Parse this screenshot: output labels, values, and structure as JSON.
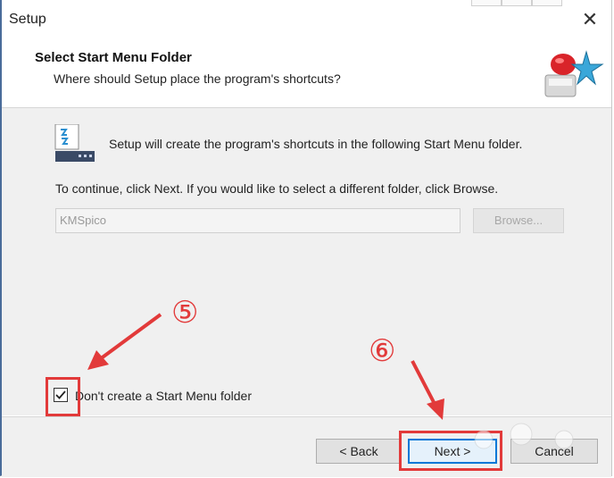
{
  "window": {
    "title": "Setup",
    "close_glyph": "✕"
  },
  "header": {
    "title": "Select Start Menu Folder",
    "subtitle": "Where should Setup place the program's shortcuts?",
    "logo_icon": "setup-wizard-logo-icon"
  },
  "body": {
    "folder_icon": "start-menu-folder-icon",
    "info_text": "Setup will create the program's shortcuts in the following Start Menu folder.",
    "continue_text": "To continue, click Next. If you would like to select a different folder, click Browse.",
    "folder_input_value": "KMSpico",
    "browse_label": "Browse...",
    "checkbox_label": "Don't create a Start Menu folder",
    "checkbox_checked": true
  },
  "footer": {
    "back_label": "< Back",
    "next_label": "Next >",
    "cancel_label": "Cancel"
  },
  "annotations": {
    "step5": "⑤",
    "step6": "⑥",
    "color": "#e23a3a"
  },
  "colors": {
    "accent": "#0078d7",
    "annotation": "#e23a3a"
  }
}
